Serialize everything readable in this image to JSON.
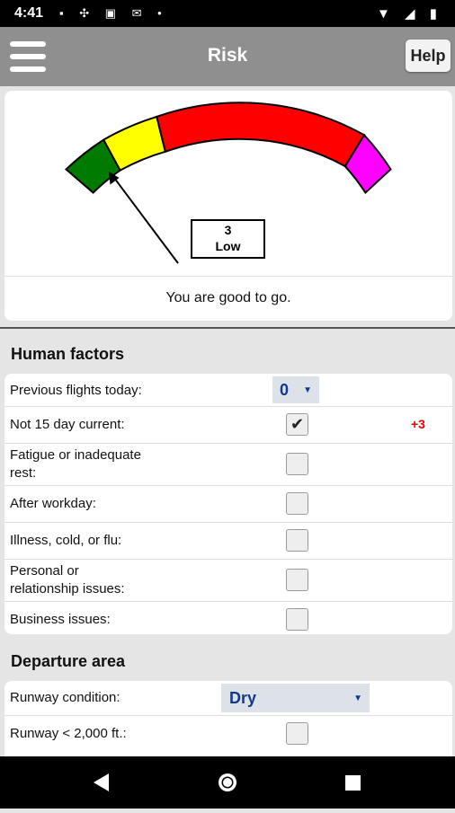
{
  "status_bar": {
    "time": "4:41",
    "left_icons": "▪ ✣ ▣ ✉ •",
    "right_icons": "▼ ◢ ▮"
  },
  "app_bar": {
    "title": "Risk",
    "help_label": "Help"
  },
  "gauge": {
    "score": "3",
    "level": "Low",
    "message": "You are good to go.",
    "colors": {
      "green": "#007b00",
      "yellow": "#ffff00",
      "red": "#ff0000",
      "magenta": "#ff00ff"
    }
  },
  "human_factors": {
    "title": "Human factors",
    "rows": [
      {
        "label": "Previous flights today:",
        "type": "select",
        "value": "0"
      },
      {
        "label": "Not 15 day current:",
        "type": "checkbox",
        "checked": true,
        "points": "+3"
      },
      {
        "label": "Fatigue or inadequate\nrest:",
        "type": "checkbox",
        "checked": false
      },
      {
        "label": "After workday:",
        "type": "checkbox",
        "checked": false
      },
      {
        "label": "Illness, cold, or flu:",
        "type": "checkbox",
        "checked": false
      },
      {
        "label": "Personal or\nrelationship issues:",
        "type": "checkbox",
        "checked": false
      },
      {
        "label": "Business issues:",
        "type": "checkbox",
        "checked": false
      }
    ]
  },
  "departure_area": {
    "title": "Departure area",
    "rows": [
      {
        "label": "Runway condition:",
        "type": "select",
        "value": "Dry"
      },
      {
        "label": "Runway < 2,000 ft.:",
        "type": "checkbox",
        "checked": false
      }
    ]
  },
  "nav_bar": {
    "back_icon": "◀",
    "home_icon": "●",
    "recents_icon": "■"
  }
}
